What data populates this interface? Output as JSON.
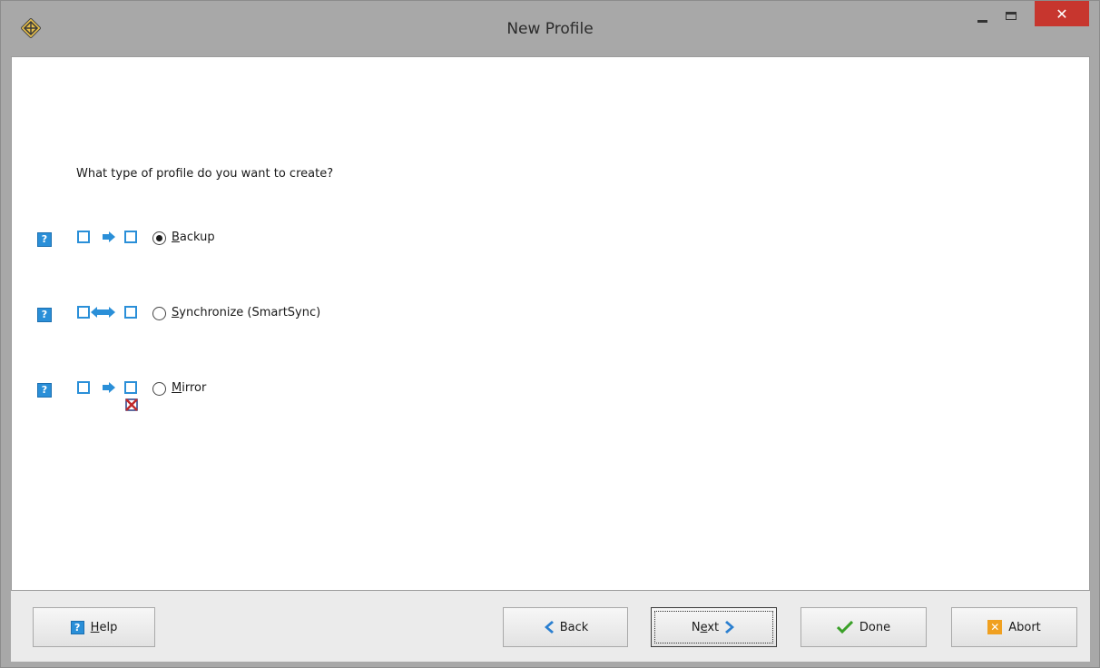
{
  "window": {
    "title": "New Profile",
    "close_glyph": "✕"
  },
  "content": {
    "question": "What type of profile do you want to create?",
    "options": [
      {
        "label_accel": "B",
        "label_rest": "ackup",
        "selected": true,
        "icon": "backup-diagram-icon"
      },
      {
        "label_accel": "S",
        "label_rest": "ynchronize (SmartSync)",
        "selected": false,
        "icon": "sync-diagram-icon"
      },
      {
        "label_accel": "M",
        "label_rest": "irror",
        "selected": false,
        "icon": "mirror-diagram-icon"
      }
    ],
    "help_glyph": "?"
  },
  "buttons": {
    "help": {
      "accel": "H",
      "rest": "elp",
      "icon": "question-icon"
    },
    "back": {
      "label": "Back",
      "icon": "chevron-left-icon"
    },
    "next": {
      "pre": "N",
      "accel": "e",
      "post": "xt",
      "icon": "chevron-right-icon"
    },
    "done": {
      "label": "Done",
      "icon": "checkmark-icon"
    },
    "abort": {
      "label": "Abort",
      "icon": "x-icon"
    }
  },
  "colors": {
    "accent_blue": "#2a8fd8",
    "close_red": "#c7362e",
    "done_green": "#3aa028",
    "abort_orange": "#f0a020"
  }
}
